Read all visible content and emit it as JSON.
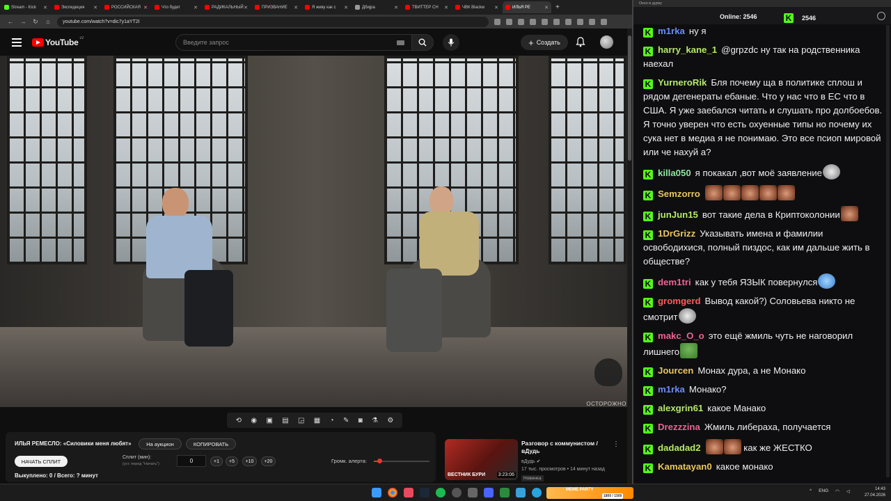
{
  "browser": {
    "tabs": [
      {
        "label": "Stream - Kick",
        "color": "#53fc18",
        "active": false
      },
      {
        "label": "Экспедиция",
        "color": "#ff0000",
        "active": false
      },
      {
        "label": "РОССИЙСКАЯ",
        "color": "#ff0000",
        "active": false
      },
      {
        "label": "Что будет",
        "color": "#ff0000",
        "active": false
      },
      {
        "label": "РАДИКАЛЬНЫЙ",
        "color": "#ff0000",
        "active": false
      },
      {
        "label": "ПРИЗВАНИЕ",
        "color": "#ff0000",
        "active": false
      },
      {
        "label": "Я живу как с",
        "color": "#ff0000",
        "active": false
      },
      {
        "label": "Дбиjра",
        "color": "#999999",
        "active": false
      },
      {
        "label": "ТВИТТЕР СН",
        "color": "#ff0000",
        "active": false
      },
      {
        "label": "ЧВК Blackw",
        "color": "#ff0000",
        "active": false
      },
      {
        "label": "ИЛЬЯ РЕ",
        "color": "#ff0000",
        "active": true
      }
    ],
    "new_tab": "+",
    "url": "youtube.com/watch?v=dic7y1aYT2I"
  },
  "youtube": {
    "logo": "YouTube",
    "country": "LV",
    "search_placeholder": "Введите запрос",
    "create_label": "Создать",
    "watermark": "ОСТОРОЖНО"
  },
  "split_panel": {
    "title": "ИЛЬЯ РЕМЕСЛО: «Силовики меня любят»",
    "auction_label": "На аукцион",
    "copy_label": "КОПИРОВАТЬ",
    "start_label": "НАЧАТЬ СПЛИТ",
    "split_label": "Сплит (мин):",
    "split_hint": "(уст. перед \"Начать\")",
    "split_value": "0",
    "inc_buttons": [
      "+1",
      "+5",
      "+10",
      "+20"
    ],
    "volume_label": "Громк. алерта:",
    "volume_level": 0.1,
    "sold_text": "Выкуплено: 0 / Всего: ? минут"
  },
  "recommended": {
    "title": "Разговор с коммунистом / вДудь",
    "channel": "вДудь",
    "meta": "17 тыс. просмотров • 14 минут назад",
    "badge": "Новинка",
    "duration": "3:23:06",
    "thumb_text": "ВЕСТНИК БУРИ"
  },
  "chat": {
    "window_title": "Окно в дурку",
    "online_label": "Online:",
    "online_count": "2546",
    "viewer_count": "2546",
    "messages": [
      {
        "user": "m1rka",
        "color": "#6b8cff",
        "text": "ну я",
        "emotes": []
      },
      {
        "user": "harry_kane_1",
        "color": "#b5e86a",
        "text": "@grpzdc ну так на родственника наехал",
        "emotes": []
      },
      {
        "user": "YurneroRik",
        "color": "#b5e86a",
        "text": "Бля почему ща в политике сплош и рядом дегенераты ебаные. Что у нас что в ЕС что в США. Я уже заебался читать и слушать про долбоебов. Я точно уверен что есть охуенные типы но почему их сука нет в медиа я не понимаю. Это все псиоп мировой или че нахуй а?",
        "emotes": []
      },
      {
        "user": "killa050",
        "color": "#8fe3a0",
        "text": "я покакал ,вот моё заявление",
        "emotes": [
          "gray"
        ]
      },
      {
        "user": "Semzorro",
        "color": "#e8c65e",
        "text": "",
        "emotes": [
          "face",
          "face",
          "face",
          "face",
          "face"
        ]
      },
      {
        "user": "junJun15",
        "color": "#b5e86a",
        "text": "вот такие дела в Криптоколонии",
        "emotes": [
          "face"
        ]
      },
      {
        "user": "1DrGrizz",
        "color": "#e8c65e",
        "text": "Указывать имена и фамилии освободихися, полный пиздос, как им дальше жить в обществе?",
        "emotes": []
      },
      {
        "user": "dem1tri",
        "color": "#f06292",
        "text": "как у тебя ЯЗЫК повернулся",
        "emotes": [
          "blob"
        ]
      },
      {
        "user": "gromgerd",
        "color": "#ff5a5a",
        "text": "Вывод какой?) Соловьева никто не смотрит",
        "emotes": [
          "gray"
        ]
      },
      {
        "user": "makc_O_o",
        "color": "#f06292",
        "text": "это ещё жмиль чуть не наговорил лишнего",
        "emotes": [
          "frog"
        ]
      },
      {
        "user": "Jourcen",
        "color": "#e8c65e",
        "text": "Монах дура, а не Монако",
        "emotes": []
      },
      {
        "user": "m1rka",
        "color": "#6b8cff",
        "text": "Монако?",
        "emotes": []
      },
      {
        "user": "alexgrin61",
        "color": "#b5e86a",
        "text": "какое Манако",
        "emotes": []
      },
      {
        "user": "Drezzzina",
        "color": "#f06292",
        "text": "Жмиль либераха, получается",
        "emotes": []
      },
      {
        "user": "dadadad2",
        "color": "#b5e86a",
        "text": "как же ЖЕСТКО",
        "emotes": [
          "face",
          "face"
        ],
        "emotes_before": true
      },
      {
        "user": "Kamatayan0",
        "color": "#e8c65e",
        "text": "какое монако",
        "emotes": []
      }
    ]
  },
  "taskbar": {
    "meme_party": "MEME PARTY",
    "meme_party_sub": "1800 / 1500",
    "lang": "ENG",
    "time": "14:43",
    "date": "27.04.2026"
  }
}
